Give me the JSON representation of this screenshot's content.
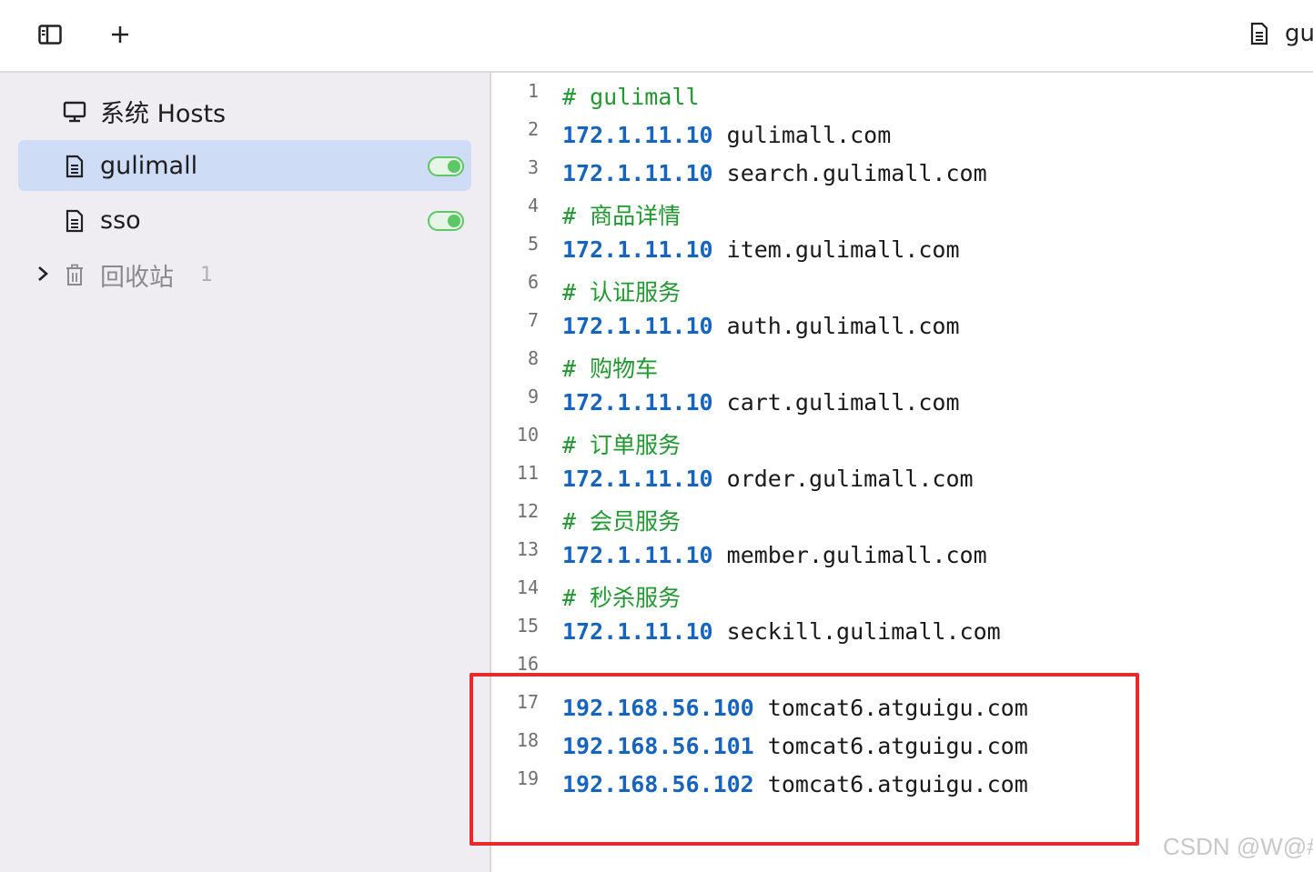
{
  "toolbar": {
    "file_tab_label": "gu"
  },
  "sidebar": {
    "items": [
      {
        "label": "系统 Hosts",
        "icon": "monitor-icon"
      },
      {
        "label": "gulimall",
        "icon": "file-icon",
        "enabled": true,
        "active": true
      },
      {
        "label": "sso",
        "icon": "file-icon",
        "enabled": true
      },
      {
        "label": "回收站",
        "icon": "trash-icon",
        "count": "1"
      }
    ]
  },
  "editor": {
    "lines": [
      {
        "n": "1",
        "comment": "# gulimall"
      },
      {
        "n": "2",
        "ip": "172.1.11.10",
        "host": "gulimall.com"
      },
      {
        "n": "3",
        "ip": "172.1.11.10",
        "host": "search.gulimall.com"
      },
      {
        "n": "4",
        "comment": "# 商品详情"
      },
      {
        "n": "5",
        "ip": "172.1.11.10",
        "host": "item.gulimall.com"
      },
      {
        "n": "6",
        "comment": "# 认证服务"
      },
      {
        "n": "7",
        "ip": "172.1.11.10",
        "host": "auth.gulimall.com"
      },
      {
        "n": "8",
        "comment": "# 购物车"
      },
      {
        "n": "9",
        "ip": "172.1.11.10",
        "host": "cart.gulimall.com"
      },
      {
        "n": "10",
        "comment": "# 订单服务"
      },
      {
        "n": "11",
        "ip": "172.1.11.10",
        "host": "order.gulimall.com"
      },
      {
        "n": "12",
        "comment": "# 会员服务"
      },
      {
        "n": "13",
        "ip": "172.1.11.10",
        "host": "member.gulimall.com"
      },
      {
        "n": "14",
        "comment": "# 秒杀服务"
      },
      {
        "n": "15",
        "ip": "172.1.11.10",
        "host": "seckill.gulimall.com"
      },
      {
        "n": "16"
      },
      {
        "n": "17",
        "ip": "192.168.56.100",
        "host": "tomcat6.atguigu.com"
      },
      {
        "n": "18",
        "ip": "192.168.56.101",
        "host": "tomcat6.atguigu.com"
      },
      {
        "n": "19",
        "ip": "192.168.56.102",
        "host": "tomcat6.atguigu.com"
      }
    ]
  },
  "watermark": "CSDN @W@#",
  "colors": {
    "ip": "#1565c0",
    "comment": "#1e9a2e",
    "highlight_box": "#e52b2b",
    "sidebar_active": "#cfdcf5",
    "toggle_on": "#5cc764"
  }
}
